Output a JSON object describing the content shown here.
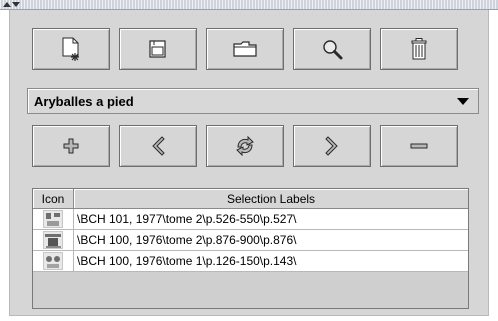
{
  "window": {
    "icons": [
      "scroll-up-arrow-icon",
      "scroll-down-arrow-icon"
    ]
  },
  "toolbar_top": {
    "buttons": [
      {
        "name": "new-document-button",
        "icon": "new-document-icon"
      },
      {
        "name": "save-button",
        "icon": "save-icon"
      },
      {
        "name": "open-folder-button",
        "icon": "folder-icon"
      },
      {
        "name": "search-button",
        "icon": "magnifier-icon"
      },
      {
        "name": "delete-button",
        "icon": "trash-icon"
      }
    ]
  },
  "selection_combo": {
    "value": "Aryballes a pied",
    "icon": "chevron-down-icon"
  },
  "toolbar_nav": {
    "buttons": [
      {
        "name": "add-button",
        "icon": "plus-icon"
      },
      {
        "name": "previous-button",
        "icon": "chevron-left-icon"
      },
      {
        "name": "refresh-button",
        "icon": "refresh-icon"
      },
      {
        "name": "next-button",
        "icon": "chevron-right-icon"
      },
      {
        "name": "remove-button",
        "icon": "minus-icon"
      }
    ]
  },
  "table": {
    "columns": [
      "Icon",
      "Selection Labels"
    ],
    "rows": [
      {
        "icon": "thumbnail-icon",
        "label": "\\BCH 101, 1977\\tome 2\\p.526-550\\p.527\\"
      },
      {
        "icon": "thumbnail-icon",
        "label": "\\BCH 100, 1976\\tome 2\\p.876-900\\p.876\\"
      },
      {
        "icon": "thumbnail-icon",
        "label": "\\BCH 100, 1976\\tome 1\\p.126-150\\p.143\\"
      }
    ]
  },
  "colors": {
    "panel_bg": "#d6d6d6",
    "button_border": "#6e6e6e",
    "icon_outline": "#2a2a2a",
    "nav_icon_fill": "#b8b8b8"
  }
}
